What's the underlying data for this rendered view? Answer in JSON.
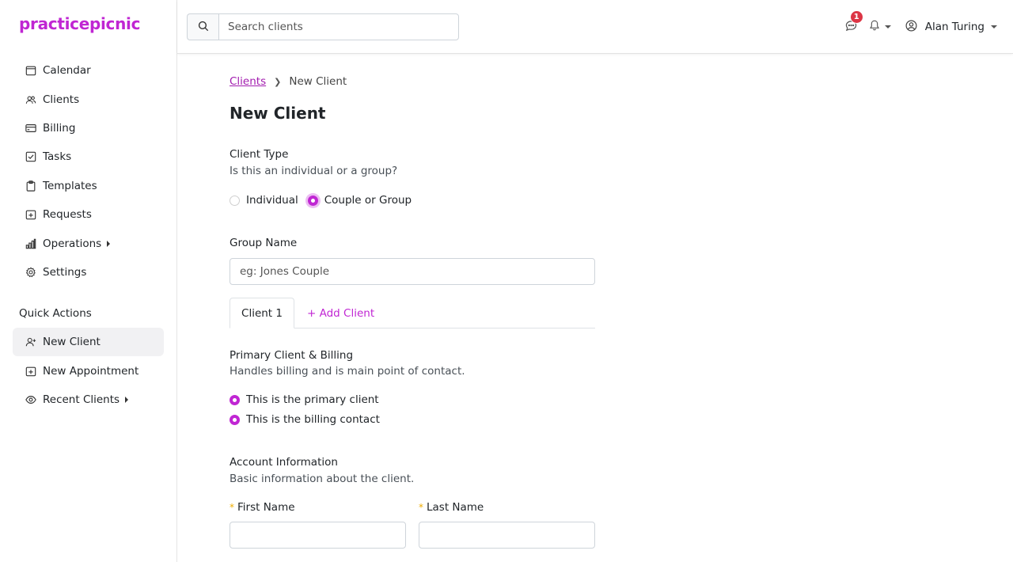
{
  "brand": "practicepicnic",
  "sidebar": {
    "nav": [
      {
        "label": "Calendar",
        "icon": "calendar-icon"
      },
      {
        "label": "Clients",
        "icon": "users-icon"
      },
      {
        "label": "Billing",
        "icon": "credit-card-icon"
      },
      {
        "label": "Tasks",
        "icon": "checkbox-icon"
      },
      {
        "label": "Templates",
        "icon": "clipboard-icon"
      },
      {
        "label": "Requests",
        "icon": "calendar-plus-icon"
      },
      {
        "label": "Operations",
        "icon": "bar-chart-icon"
      },
      {
        "label": "Settings",
        "icon": "gear-icon"
      }
    ],
    "quick_actions_title": "Quick Actions",
    "quick_actions": [
      {
        "label": "New Client",
        "icon": "person-add-icon"
      },
      {
        "label": "New Appointment",
        "icon": "calendar-plus-icon"
      },
      {
        "label": "Recent Clients",
        "icon": "eye-icon"
      }
    ]
  },
  "topbar": {
    "search_placeholder": "Search clients",
    "message_count": "1",
    "user_name": "Alan Turing"
  },
  "main": {
    "breadcrumb_root": "Clients",
    "breadcrumb_current": "New Client",
    "page_title": "New Client",
    "client_type": {
      "title": "Client Type",
      "subtitle": "Is this an individual or a group?",
      "options": [
        "Individual",
        "Couple or Group"
      ]
    },
    "group_name": {
      "label": "Group Name",
      "placeholder": "eg: Jones Couple"
    },
    "tabs": {
      "active": "Client 1",
      "add": "+ Add Client"
    },
    "primary": {
      "title": "Primary Client & Billing",
      "subtitle": "Handles billing and is main point of contact.",
      "options": [
        "This is the primary client",
        "This is the billing contact"
      ]
    },
    "account": {
      "title": "Account Information",
      "subtitle": "Basic information about the client.",
      "first_name_label": "First Name",
      "last_name_label": "Last Name",
      "required_mark": "*"
    }
  },
  "colors": {
    "accent": "#c026d3",
    "required": "#f0ad00",
    "badge": "#dc3545"
  }
}
